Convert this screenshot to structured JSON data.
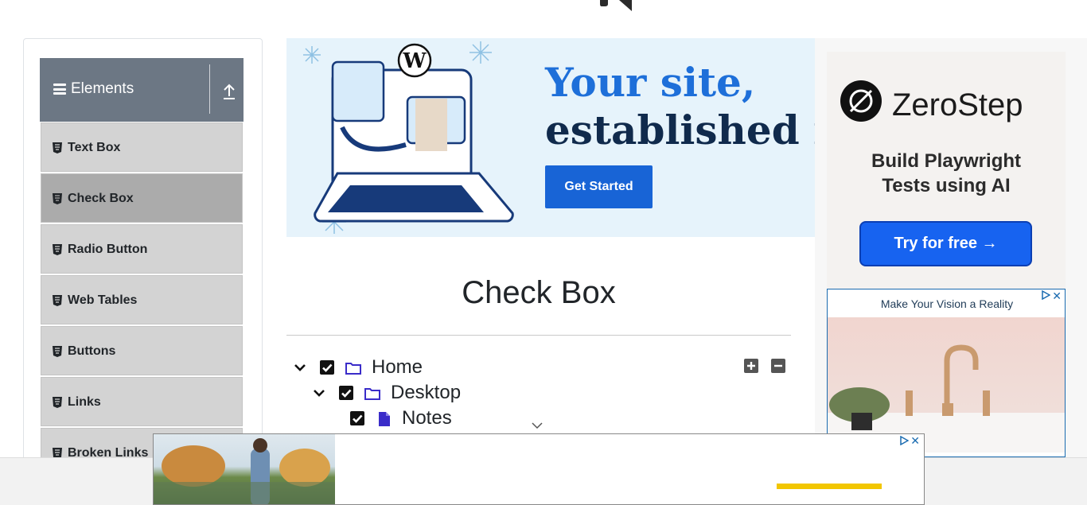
{
  "sidebar": {
    "group_title": "Elements",
    "items": [
      {
        "label": "Text Box"
      },
      {
        "label": "Check Box"
      },
      {
        "label": "Radio Button"
      },
      {
        "label": "Web Tables"
      },
      {
        "label": "Buttons"
      },
      {
        "label": "Links"
      },
      {
        "label": "Broken Links"
      }
    ],
    "active_item": "Check Box"
  },
  "banner": {
    "headline_line1": "Your site,",
    "headline_line2": "established in",
    "cta_label": "Get Started"
  },
  "main": {
    "title": "Check Box",
    "tree": [
      {
        "label": "Home",
        "icon": "folder-icon",
        "checked": true,
        "expanded": true
      },
      {
        "label": "Desktop",
        "icon": "folder-icon",
        "checked": true,
        "expanded": true
      },
      {
        "label": "Notes",
        "icon": "file-icon",
        "checked": true
      }
    ]
  },
  "ads": {
    "zerostep_brand": "ZeroStep",
    "zerostep_tagline_1": "Build Playwright",
    "zerostep_tagline_2": "Tests using AI",
    "zerostep_cta": "Try for free →",
    "vision_title": "Make Your Vision a Reality",
    "close_symbol": "✕"
  },
  "colors": {
    "sidebar_header": "#6c7784",
    "menu_item": "#d3d3d3",
    "menu_item_active": "#ababab",
    "folder_icon": "#3a2cc9",
    "cta_blue": "#1864d6"
  }
}
